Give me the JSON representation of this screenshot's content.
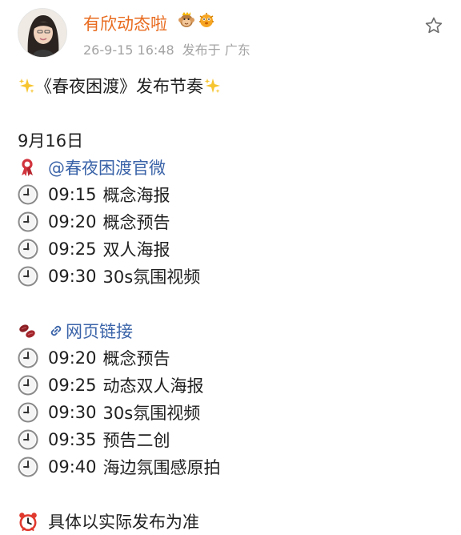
{
  "author": {
    "name": "有欣动态啦",
    "timestamp": "26-9-15 16:48",
    "source": "发布于 广东",
    "badge_icons": [
      "monkey-emoji-badge",
      "pufferfish-emoji-badge"
    ]
  },
  "actions": {
    "star_icon": "star-outline-icon"
  },
  "post": {
    "headline": "《春夜困渡》发布节奏",
    "date": "9月16日",
    "section1": {
      "icon": "ribbon-icon",
      "link_text": "@春夜困渡官微",
      "items": [
        {
          "time": "09:15",
          "text": "概念海报"
        },
        {
          "time": "09:20",
          "text": "概念预告"
        },
        {
          "time": "09:25",
          "text": "双人海报"
        },
        {
          "time": "09:30",
          "text": "30s氛围视频"
        }
      ]
    },
    "section2": {
      "icon": "beans-icon",
      "link_text": "网页链接",
      "items": [
        {
          "time": "09:20",
          "text": "概念预告"
        },
        {
          "time": "09:25",
          "text": "动态双人海报"
        },
        {
          "time": "09:30",
          "text": "30s氛围视频"
        },
        {
          "time": "09:35",
          "text": "预告二创"
        },
        {
          "time": "09:40",
          "text": "海边氛围感原拍"
        }
      ]
    },
    "footer_note": "具体以实际发布为准"
  },
  "colors": {
    "username": "#e86b1f",
    "link": "#3a63a8",
    "meta": "#a3a3a3"
  }
}
